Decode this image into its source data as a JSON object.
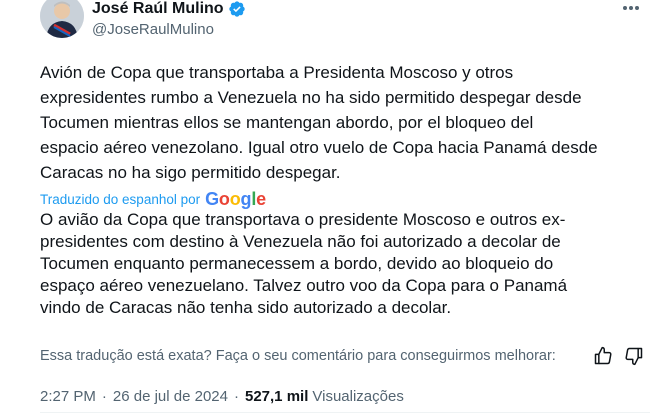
{
  "author": {
    "name": "José Raúl Mulino",
    "handle": "@JoseRaulMulino",
    "verified_color": "#1d9bf0"
  },
  "tweet": {
    "original_lines": [
      "Avión de Copa que transportaba a Presidenta Moscoso y otros",
      "expresidentes rumbo a Venezuela  no ha sido permitido despegar desde",
      "Tocumen mientras ellos se mantengan abordo, por el bloqueo del",
      "espacio aéreo venezolano. Igual otro vuelo de Copa hacia Panamá desde",
      "Caracas no ha sigo permitido despegar."
    ],
    "translated_by_label": "Traduzido do espanhol por",
    "provider_logo_text": "Google",
    "translation_lines": [
      "O avião da Copa que transportava o presidente Moscoso e outros ex-",
      "presidentes com destino à Venezuela não foi autorizado a decolar de",
      "Tocumen enquanto permanecessem a bordo, devido ao bloqueio do",
      "espaço aéreo venezuelano. Talvez outro voo da Copa para o Panamá",
      "vindo de Caracas não tenha sido autorizado a decolar."
    ]
  },
  "feedback": {
    "question": "Essa tradução está exata? Faça o seu comentário para conseguirmos melhorar:",
    "thumbs_up_icon": "thumbs-up-icon",
    "thumbs_down_icon": "thumbs-down-icon"
  },
  "meta": {
    "time": "2:27 PM",
    "separator": "·",
    "date": "26 de jul de 2024",
    "views_count": "527,1 mil",
    "views_label": "Visualizações"
  },
  "colors": {
    "accent": "#1d9bf0",
    "secondary_text": "#536471",
    "primary_text": "#0f1419"
  }
}
